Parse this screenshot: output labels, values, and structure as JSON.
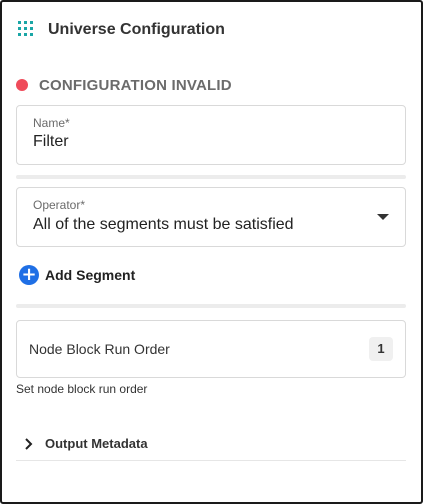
{
  "header": {
    "title": "Universe Configuration",
    "icon": "grid-apps-icon",
    "icon_color": "#1aa6a6"
  },
  "status": {
    "text": "CONFIGURATION INVALID",
    "dot_color": "#ef4b5a",
    "text_color": "#6b6b6b"
  },
  "name_field": {
    "label": "Name*",
    "value": "Filter"
  },
  "operator_field": {
    "label": "Operator*",
    "value": "All of the segments must be satisfied"
  },
  "add_segment": {
    "label": "Add Segment",
    "icon": "plus-circle-icon",
    "icon_color": "#1f6fe5"
  },
  "run_order": {
    "label": "Node Block Run Order",
    "value": "1",
    "helper": "Set node block run order"
  },
  "output_metadata": {
    "label": "Output Metadata",
    "icon": "chevron-right-icon"
  }
}
